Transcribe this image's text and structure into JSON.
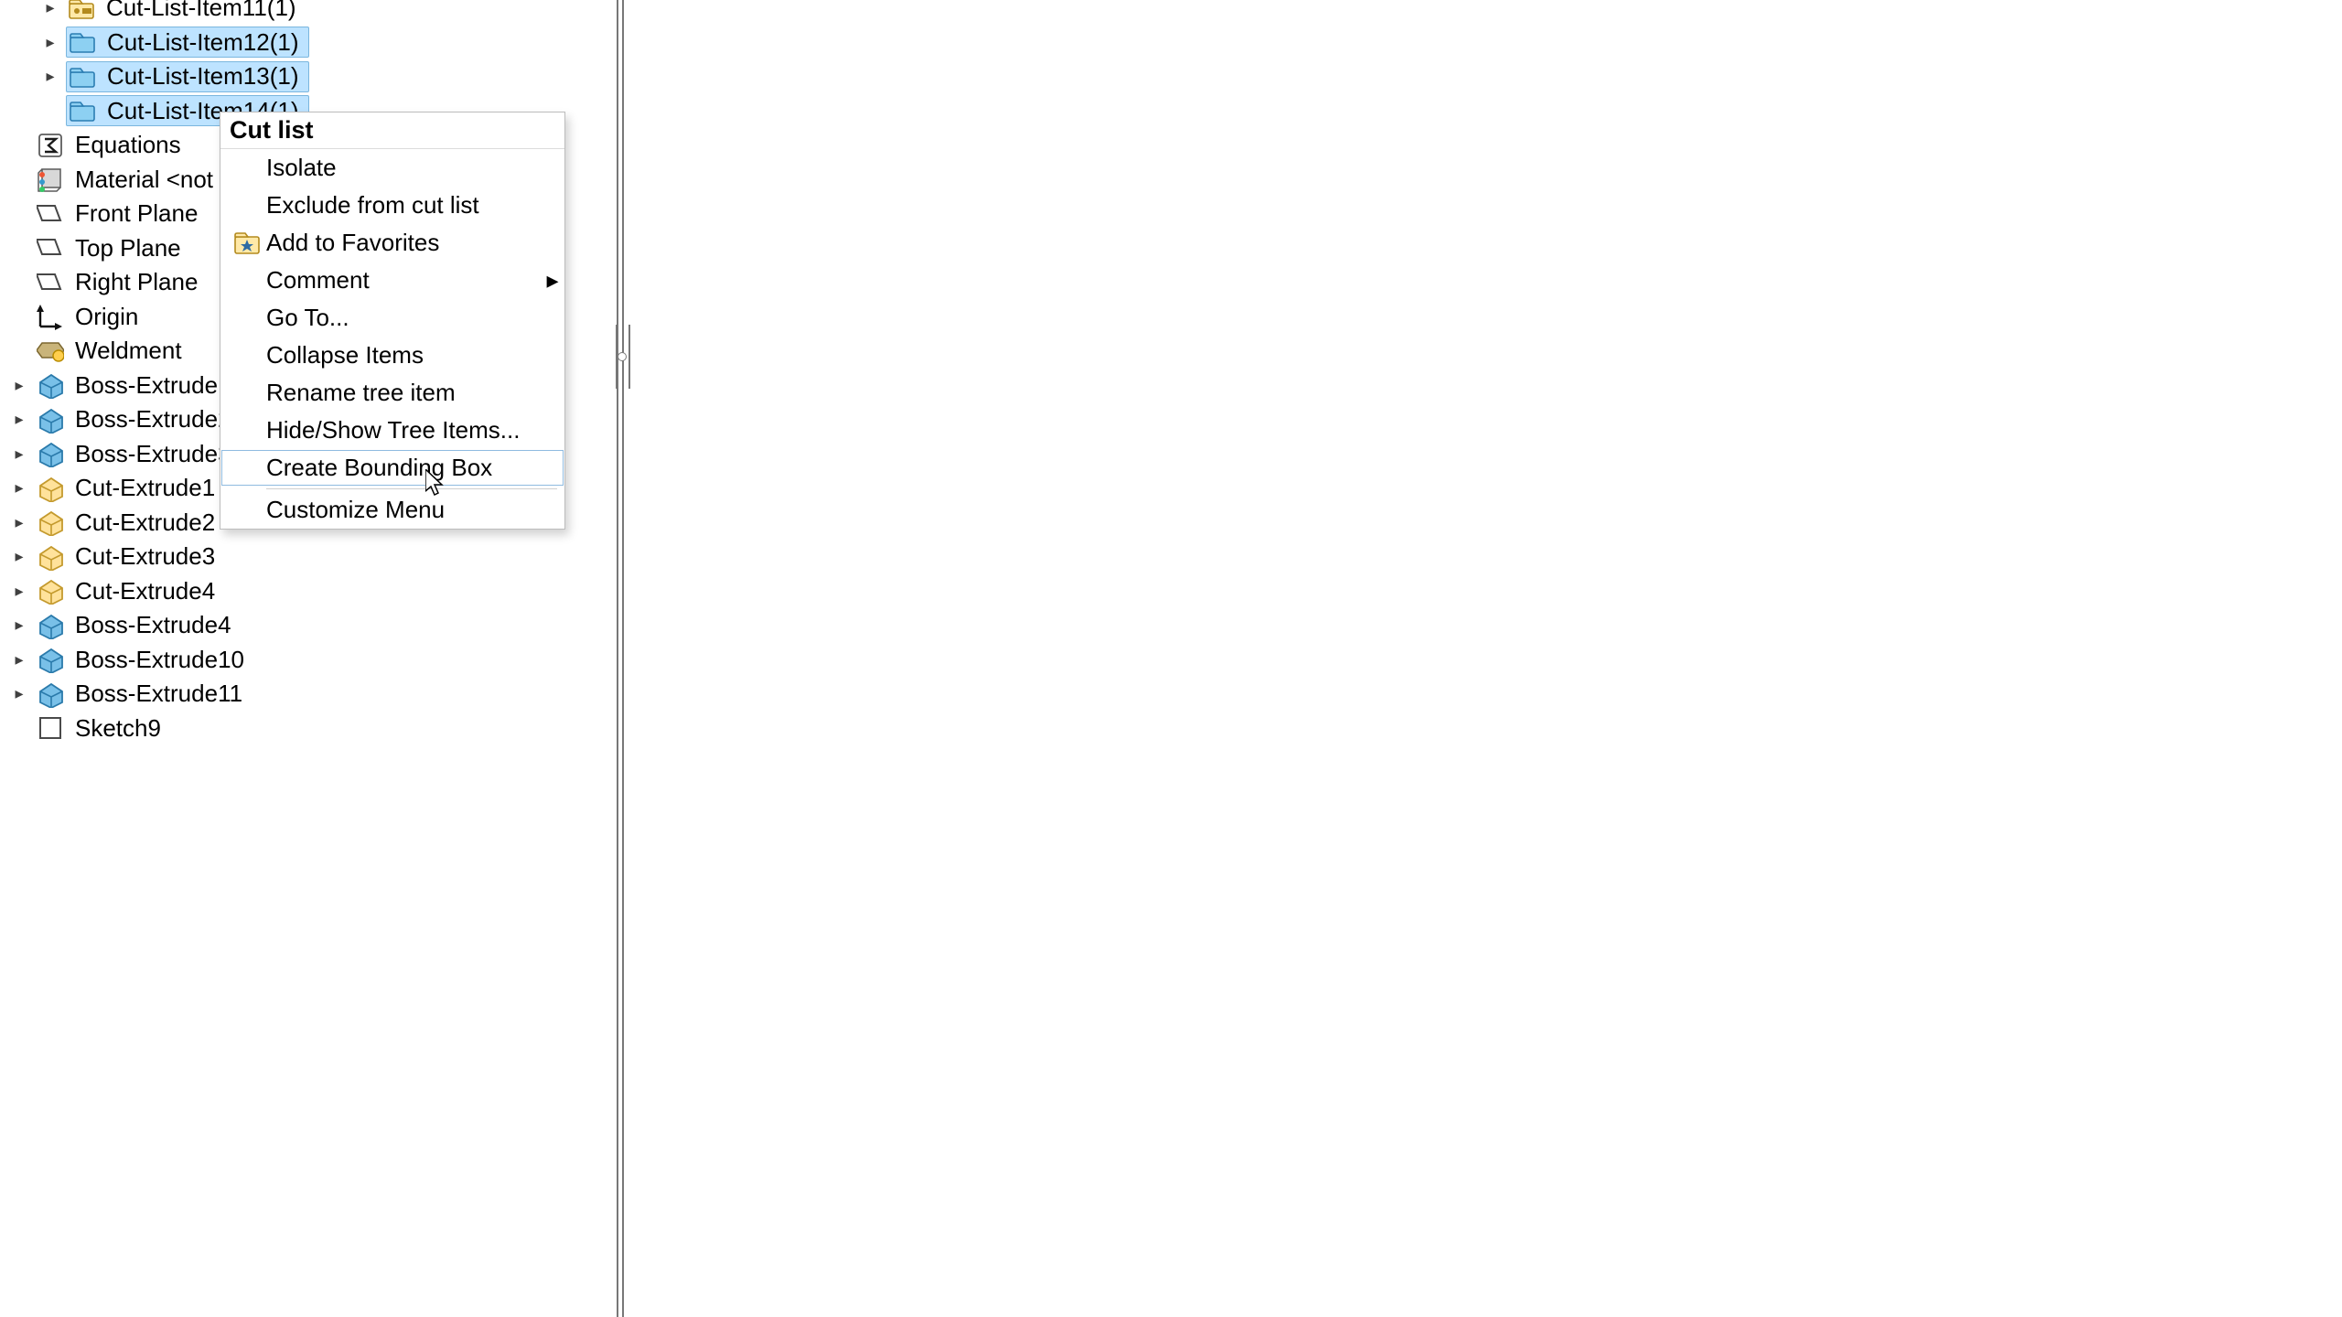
{
  "tree": {
    "items": [
      {
        "label": "Cut-List-Item11(1)",
        "indent": 1,
        "chevron": true,
        "icon": "cutlistitem",
        "selected": false
      },
      {
        "label": "Cut-List-Item12(1)",
        "indent": 1,
        "chevron": true,
        "icon": "folder",
        "selected": true
      },
      {
        "label": "Cut-List-Item13(1)",
        "indent": 1,
        "chevron": true,
        "icon": "folder",
        "selected": true
      },
      {
        "label": "Cut-List-Item14(1)",
        "indent": 1,
        "chevron": false,
        "icon": "folder",
        "selected": true
      },
      {
        "label": "Equations",
        "indent": 0,
        "chevron": false,
        "icon": "sigma",
        "selected": false
      },
      {
        "label": "Material <not specified>",
        "indent": 0,
        "chevron": false,
        "icon": "material",
        "selected": false
      },
      {
        "label": "Front Plane",
        "indent": 0,
        "chevron": false,
        "icon": "plane",
        "selected": false
      },
      {
        "label": "Top Plane",
        "indent": 0,
        "chevron": false,
        "icon": "plane",
        "selected": false
      },
      {
        "label": "Right Plane",
        "indent": 0,
        "chevron": false,
        "icon": "plane",
        "selected": false
      },
      {
        "label": "Origin",
        "indent": 0,
        "chevron": false,
        "icon": "origin",
        "selected": false
      },
      {
        "label": "Weldment",
        "indent": 0,
        "chevron": false,
        "icon": "weldment",
        "selected": false
      },
      {
        "label": "Boss-Extrude1",
        "indent": 0,
        "chevron": true,
        "icon": "boss",
        "selected": false
      },
      {
        "label": "Boss-Extrude2",
        "indent": 0,
        "chevron": true,
        "icon": "boss",
        "selected": false
      },
      {
        "label": "Boss-Extrude3",
        "indent": 0,
        "chevron": true,
        "icon": "boss",
        "selected": false
      },
      {
        "label": "Cut-Extrude1",
        "indent": 0,
        "chevron": true,
        "icon": "cut",
        "selected": false
      },
      {
        "label": "Cut-Extrude2",
        "indent": 0,
        "chevron": true,
        "icon": "cut",
        "selected": false
      },
      {
        "label": "Cut-Extrude3",
        "indent": 0,
        "chevron": true,
        "icon": "cut",
        "selected": false
      },
      {
        "label": "Cut-Extrude4",
        "indent": 0,
        "chevron": true,
        "icon": "cut",
        "selected": false
      },
      {
        "label": "Boss-Extrude4",
        "indent": 0,
        "chevron": true,
        "icon": "boss",
        "selected": false
      },
      {
        "label": "Boss-Extrude10",
        "indent": 0,
        "chevron": true,
        "icon": "boss",
        "selected": false
      },
      {
        "label": "Boss-Extrude11",
        "indent": 0,
        "chevron": true,
        "icon": "boss",
        "selected": false
      },
      {
        "label": "Sketch9",
        "indent": 0,
        "chevron": false,
        "icon": "sketch",
        "selected": false
      }
    ]
  },
  "context_menu": {
    "title": "Cut list",
    "items": [
      {
        "label": "Isolate",
        "icon": null,
        "submenu": false,
        "hovered": false
      },
      {
        "label": "Exclude from cut list",
        "icon": null,
        "submenu": false,
        "hovered": false
      },
      {
        "label": "Add to Favorites",
        "icon": "favorite",
        "submenu": false,
        "hovered": false
      },
      {
        "label": "Comment",
        "icon": null,
        "submenu": true,
        "hovered": false
      },
      {
        "label": "Go To...",
        "icon": null,
        "submenu": false,
        "hovered": false
      },
      {
        "label": "Collapse Items",
        "icon": null,
        "submenu": false,
        "hovered": false
      },
      {
        "label": "Rename tree item",
        "icon": null,
        "submenu": false,
        "hovered": false
      },
      {
        "label": "Hide/Show Tree Items...",
        "icon": null,
        "submenu": false,
        "hovered": false
      },
      {
        "label": "Create Bounding Box",
        "icon": null,
        "submenu": false,
        "hovered": true
      },
      {
        "separator": true
      },
      {
        "label": "Customize Menu",
        "icon": null,
        "submenu": false,
        "hovered": false
      }
    ]
  }
}
